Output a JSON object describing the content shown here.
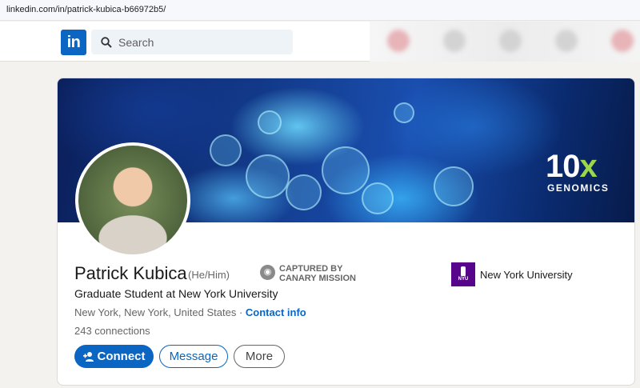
{
  "browser": {
    "url": "linkedin.com/in/patrick-kubica-b66972b5/"
  },
  "nav": {
    "logo": "in",
    "search_placeholder": "Search"
  },
  "banner": {
    "brand_number": "10",
    "brand_x": "x",
    "brand_word": "GENOMICS"
  },
  "profile": {
    "name": "Patrick Kubica",
    "pronouns": "(He/Him)",
    "badge_line1": "CAPTURED BY",
    "badge_line2": "CANARY MISSION",
    "headline": "Graduate Student at New York University",
    "location": "New York, New York, United States",
    "separator": " · ",
    "contact_info": "Contact info",
    "connections": "243 connections"
  },
  "actions": {
    "connect": "Connect",
    "message": "Message",
    "more": "More"
  },
  "education": {
    "name": "New York University",
    "logo_text": "NYU"
  },
  "colors": {
    "brand_blue": "#0a66c2",
    "nyu_purple": "#57068c",
    "banner_accent": "#9ad84b"
  },
  "icons": [
    "search-icon",
    "add-person-icon",
    "camera-badge-icon",
    "nyu-torch-logo"
  ]
}
